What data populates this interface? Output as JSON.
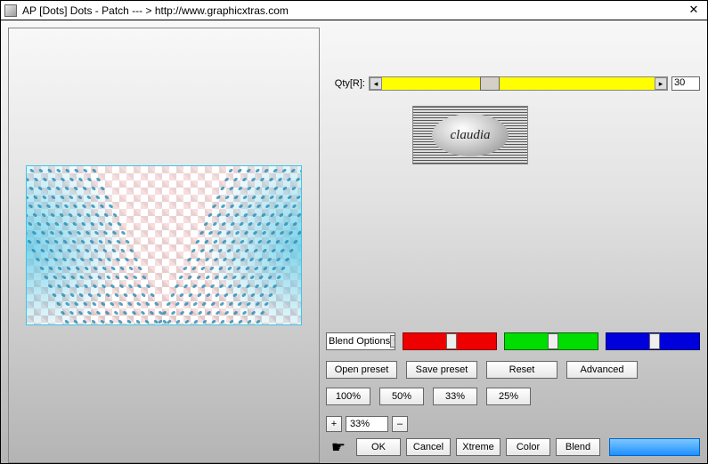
{
  "titlebar": {
    "title": "AP [Dots]  Dots - Patch   --- >  http://www.graphicxtras.com"
  },
  "qty": {
    "label": "Qty[R]:",
    "value": "30"
  },
  "logo": {
    "text": "claudia"
  },
  "blend_select": {
    "label": "Blend Options"
  },
  "row_presets": {
    "open": "Open preset",
    "save": "Save preset",
    "reset": "Reset",
    "advanced": "Advanced"
  },
  "row_zoom": {
    "z100": "100%",
    "z50": "50%",
    "z33": "33%",
    "z25": "25%"
  },
  "scale": {
    "plus": "+",
    "minus": "–",
    "value": "33%"
  },
  "bottom": {
    "ok": "OK",
    "cancel": "Cancel",
    "xtreme": "Xtreme",
    "color": "Color",
    "blend": "Blend"
  },
  "colors": {
    "swatch": "#3ea9ff"
  }
}
